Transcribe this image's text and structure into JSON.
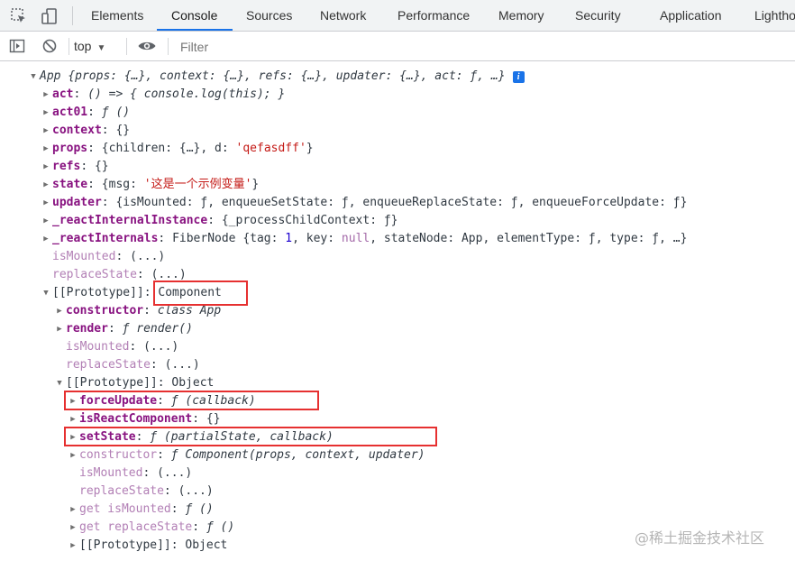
{
  "tabs": [
    "Elements",
    "Console",
    "Sources",
    "Network",
    "Performance",
    "Memory",
    "Security",
    "Application",
    "Lighthouse"
  ],
  "active_tab": "Console",
  "toolbar": {
    "context": "top",
    "filter_placeholder": "Filter"
  },
  "tree": {
    "root_key": "App",
    "root_preview": "{props: {…}, context: {…}, refs: {…}, updater: {…}, act: ƒ, …}",
    "info_badge": "i",
    "act": {
      "key": "act",
      "value": "() => { console.log(this); }"
    },
    "act01": {
      "key": "act01",
      "value": "ƒ ()"
    },
    "context": {
      "key": "context",
      "value": "{}"
    },
    "props": {
      "key": "props",
      "value_prefix": "{children: {…}, d: ",
      "value_str": "'qefasdff'",
      "value_suffix": "}"
    },
    "refs": {
      "key": "refs",
      "value": "{}"
    },
    "state": {
      "key": "state",
      "value_prefix": "{msg: ",
      "value_str": "'这是一个示例变量'",
      "value_suffix": "}"
    },
    "updater": {
      "key": "updater",
      "value": "{isMounted: ƒ, enqueueSetState: ƒ, enqueueReplaceState: ƒ, enqueueForceUpdate: ƒ}"
    },
    "internal_instance": {
      "key": "_reactInternalInstance",
      "value": "{_processChildContext: ƒ}"
    },
    "internals": {
      "key": "_reactInternals",
      "value_prefix": "FiberNode {tag: ",
      "value_num": "1",
      "value_mid": ", key: ",
      "value_null": "null",
      "value_suffix": ", stateNode: App, elementType: ƒ, type: ƒ, …}"
    },
    "is_mounted_1": {
      "key": "isMounted",
      "value": "(...)"
    },
    "replace_state_1": {
      "key": "replaceState",
      "value": "(...)"
    },
    "proto1": {
      "key": "[[Prototype]]",
      "value": "Component"
    },
    "constructor1": {
      "key": "constructor",
      "value": "class App"
    },
    "render": {
      "key": "render",
      "value": "ƒ render()"
    },
    "is_mounted_2": {
      "key": "isMounted",
      "value": "(...)"
    },
    "replace_state_2": {
      "key": "replaceState",
      "value": "(...)"
    },
    "proto2": {
      "key": "[[Prototype]]",
      "value": "Object"
    },
    "force_update": {
      "key": "forceUpdate",
      "value": "ƒ (callback)"
    },
    "is_react_component": {
      "key": "isReactComponent",
      "value": "{}"
    },
    "set_state": {
      "key": "setState",
      "value": "ƒ (partialState, callback)"
    },
    "constructor2": {
      "key": "constructor",
      "value": "ƒ Component(props, context, updater)"
    },
    "is_mounted_3": {
      "key": "isMounted",
      "value": "(...)"
    },
    "replace_state_3": {
      "key": "replaceState",
      "value": "(...)"
    },
    "get_is_mounted": {
      "key": "get isMounted",
      "value": "ƒ ()"
    },
    "get_replace_state": {
      "key": "get replaceState",
      "value": "ƒ ()"
    },
    "proto3": {
      "key": "[[Prototype]]",
      "value": "Object"
    }
  },
  "watermark": "@稀土掘金技术社区",
  "colors": {
    "highlight": "#e63030",
    "accent": "#1a73e8",
    "key": "#881280",
    "string": "#c41a16"
  }
}
